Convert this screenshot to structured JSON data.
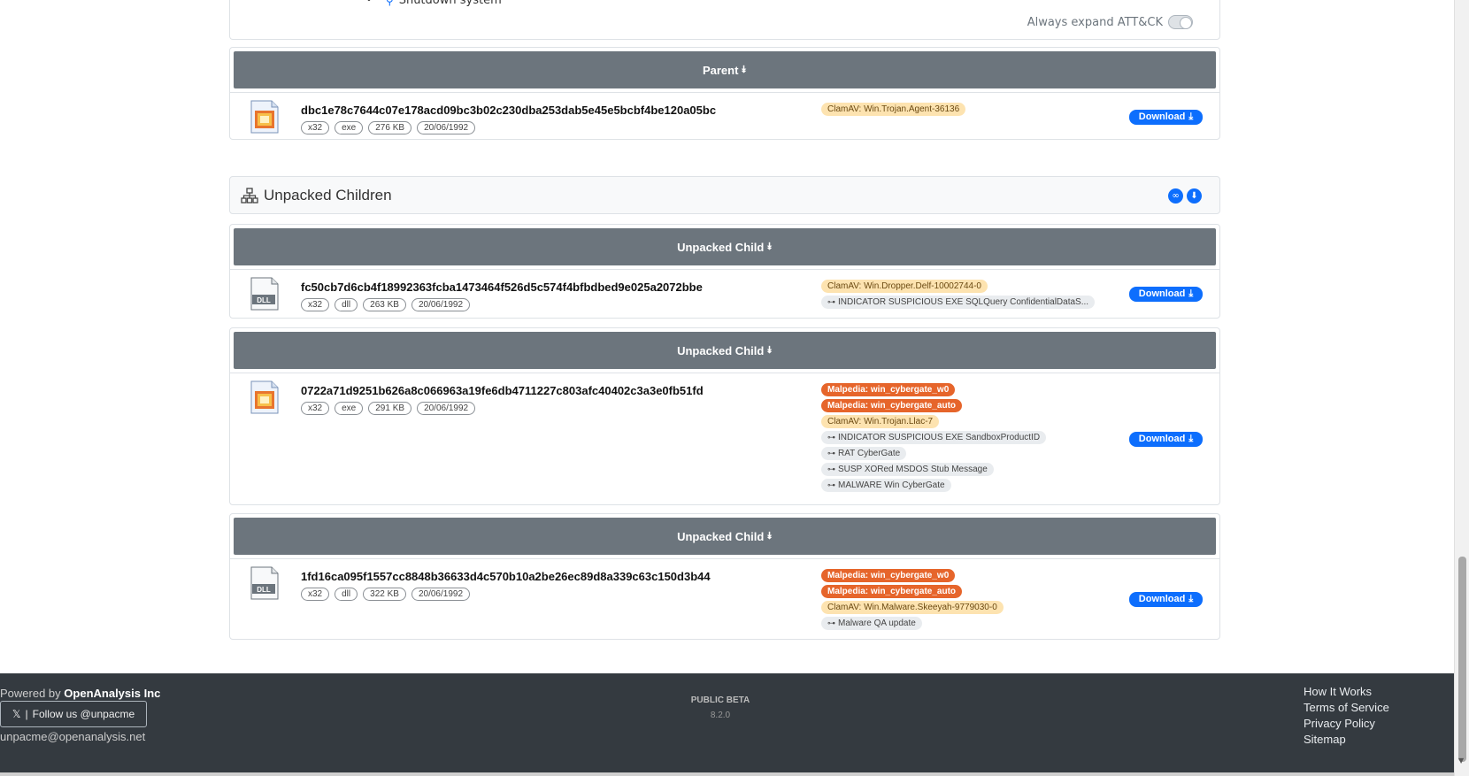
{
  "attack": {
    "partial_item": "Shutdown system",
    "toggle_label": "Always expand ATT&CK"
  },
  "parent": {
    "header": "Parent",
    "hash": "dbc1e78c7644c07e178acd09bc3b02c230dba253dab5e45e5bcbf4be120a05bc",
    "icon": "exe-file-icon",
    "tags": [
      "x32",
      "exe",
      "276 KB",
      "20/06/1992"
    ],
    "badges": [
      {
        "kind": "clam",
        "text": "ClamAV: Win.Trojan.Agent-36136"
      }
    ],
    "download_label": "Download"
  },
  "children_section": {
    "title": "Unpacked Children"
  },
  "children": [
    {
      "header": "Unpacked Child",
      "hash": "fc50cb7d6cb4f18992363fcba1473464f526d5c574f4bfbdbed9e025a2072bbe",
      "icon": "dll-file-icon",
      "tags": [
        "x32",
        "dll",
        "263 KB",
        "20/06/1992"
      ],
      "badges": [
        {
          "kind": "clam",
          "text": "ClamAV: Win.Dropper.Delf-10002744-0"
        },
        {
          "kind": "yara",
          "text": "INDICATOR SUSPICIOUS EXE SQLQuery ConfidentialDataS..."
        }
      ],
      "download_label": "Download"
    },
    {
      "header": "Unpacked Child",
      "hash": "0722a71d9251b626a8c066963a19fe6db4711227c803afc40402c3a3e0fb51fd",
      "icon": "exe-file-icon",
      "tags": [
        "x32",
        "exe",
        "291 KB",
        "20/06/1992"
      ],
      "badges": [
        {
          "kind": "malp",
          "text": "Malpedia: win_cybergate_w0"
        },
        {
          "kind": "malp",
          "text": "Malpedia: win_cybergate_auto"
        },
        {
          "kind": "clam",
          "text": "ClamAV: Win.Trojan.Llac-7"
        },
        {
          "kind": "yara",
          "text": "INDICATOR SUSPICIOUS EXE SandboxProductID"
        },
        {
          "kind": "yara",
          "text": "RAT CyberGate"
        },
        {
          "kind": "yara",
          "text": "SUSP XORed MSDOS Stub Message"
        },
        {
          "kind": "yara",
          "text": "MALWARE Win CyberGate"
        }
      ],
      "download_label": "Download"
    },
    {
      "header": "Unpacked Child",
      "hash": "1fd16ca095f1557cc8848b36633d4c570b10a2be26ec89d8a339c63c150d3b44",
      "icon": "dll-file-icon",
      "tags": [
        "x32",
        "dll",
        "322 KB",
        "20/06/1992"
      ],
      "badges": [
        {
          "kind": "malp",
          "text": "Malpedia: win_cybergate_w0"
        },
        {
          "kind": "malp",
          "text": "Malpedia: win_cybergate_auto"
        },
        {
          "kind": "clam",
          "text": "ClamAV: Win.Malware.Skeeyah-9779030-0"
        },
        {
          "kind": "yara",
          "text": "Malware QA update"
        }
      ],
      "download_label": "Download"
    }
  ],
  "footer": {
    "powered_prefix": "Powered by",
    "powered_company": "OpenAnalysis Inc",
    "follow_label": "Follow us @unpacme",
    "email": "unpacme@openanalysis.net",
    "beta_label": "PUBLIC BETA",
    "version": "8.2.0",
    "links": [
      "How It Works",
      "Terms of Service",
      "Privacy Policy",
      "Sitemap"
    ]
  }
}
